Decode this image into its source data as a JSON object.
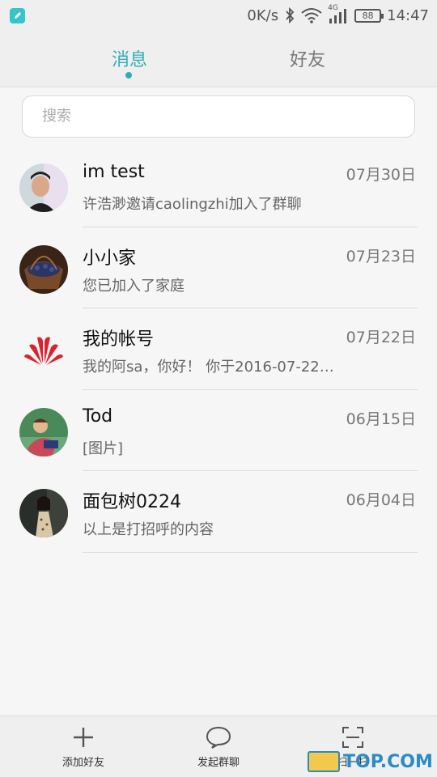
{
  "status_bar": {
    "network_speed": "0K/s",
    "signal_type": "4G",
    "battery": "88",
    "time": "14:47",
    "icons": [
      "app-badge-icon",
      "bluetooth-icon",
      "wifi-icon",
      "signal-icon",
      "battery-icon"
    ]
  },
  "tabs": [
    {
      "label": "消息",
      "active": true
    },
    {
      "label": "好友",
      "active": false
    }
  ],
  "search": {
    "placeholder": "搜索"
  },
  "conversations": [
    {
      "name": "im test",
      "date": "07月30日",
      "message": "许浩渺邀请caolingzhi加入了群聊",
      "avatar": "person-photo"
    },
    {
      "name": "小小家",
      "date": "07月23日",
      "message": "您已加入了家庭",
      "avatar": "berries-photo"
    },
    {
      "name": "我的帐号",
      "date": "07月22日",
      "message": "我的阿sa，你好！ 你于2016-07-22…",
      "avatar": "huawei-logo"
    },
    {
      "name": "Tod",
      "date": "06月15日",
      "message": "[图片]",
      "avatar": "child-photo"
    },
    {
      "name": "面包树0224",
      "date": "06月04日",
      "message": "以上是打招呼的内容",
      "avatar": "woman-photo"
    }
  ],
  "bottom_bar": [
    {
      "label": "添加好友",
      "icon": "plus-icon"
    },
    {
      "label": "发起群聊",
      "icon": "chat-bubble-icon"
    },
    {
      "label": "扫一扫",
      "icon": "scan-icon"
    }
  ],
  "watermark": {
    "text": "TOP.COM"
  },
  "colors": {
    "accent": "#32adb7",
    "background": "#f6f6f6",
    "bar": "#efefef"
  }
}
